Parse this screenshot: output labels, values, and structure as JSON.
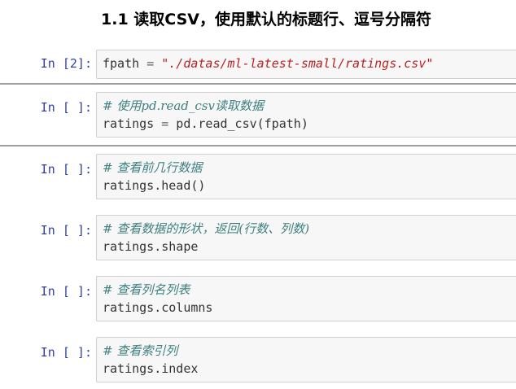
{
  "heading": "1.1 读取CSV，使用默认的标题行、逗号分隔符",
  "cells": [
    {
      "prompt": "In [2]:",
      "lines": [
        [
          {
            "t": "plain",
            "v": "fpath "
          },
          {
            "t": "op",
            "v": "="
          },
          {
            "t": "plain",
            "v": " "
          },
          {
            "t": "str",
            "v": "\"./datas/ml-latest-small/ratings.csv\""
          }
        ]
      ]
    },
    {
      "prompt": "In [ ]:",
      "lines": [
        [
          {
            "t": "comment",
            "v": "# 使用pd.read_csv读取数据"
          }
        ],
        [
          {
            "t": "plain",
            "v": "ratings "
          },
          {
            "t": "op",
            "v": "="
          },
          {
            "t": "plain",
            "v": " pd.read_csv(fpath)"
          }
        ]
      ]
    },
    {
      "prompt": "In [ ]:",
      "lines": [
        [
          {
            "t": "comment",
            "v": "# 查看前几行数据"
          }
        ],
        [
          {
            "t": "plain",
            "v": "ratings.head()"
          }
        ]
      ]
    },
    {
      "prompt": "In [ ]:",
      "lines": [
        [
          {
            "t": "comment",
            "v": "# 查看数据的形状，返回(行数、列数)"
          }
        ],
        [
          {
            "t": "plain",
            "v": "ratings.shape"
          }
        ]
      ]
    },
    {
      "prompt": "In [ ]:",
      "lines": [
        [
          {
            "t": "comment",
            "v": "# 查看列名列表"
          }
        ],
        [
          {
            "t": "plain",
            "v": "ratings.columns"
          }
        ]
      ]
    },
    {
      "prompt": "In [ ]:",
      "lines": [
        [
          {
            "t": "comment",
            "v": "# 查看索引列"
          }
        ],
        [
          {
            "t": "plain",
            "v": "ratings.index"
          }
        ]
      ]
    }
  ]
}
